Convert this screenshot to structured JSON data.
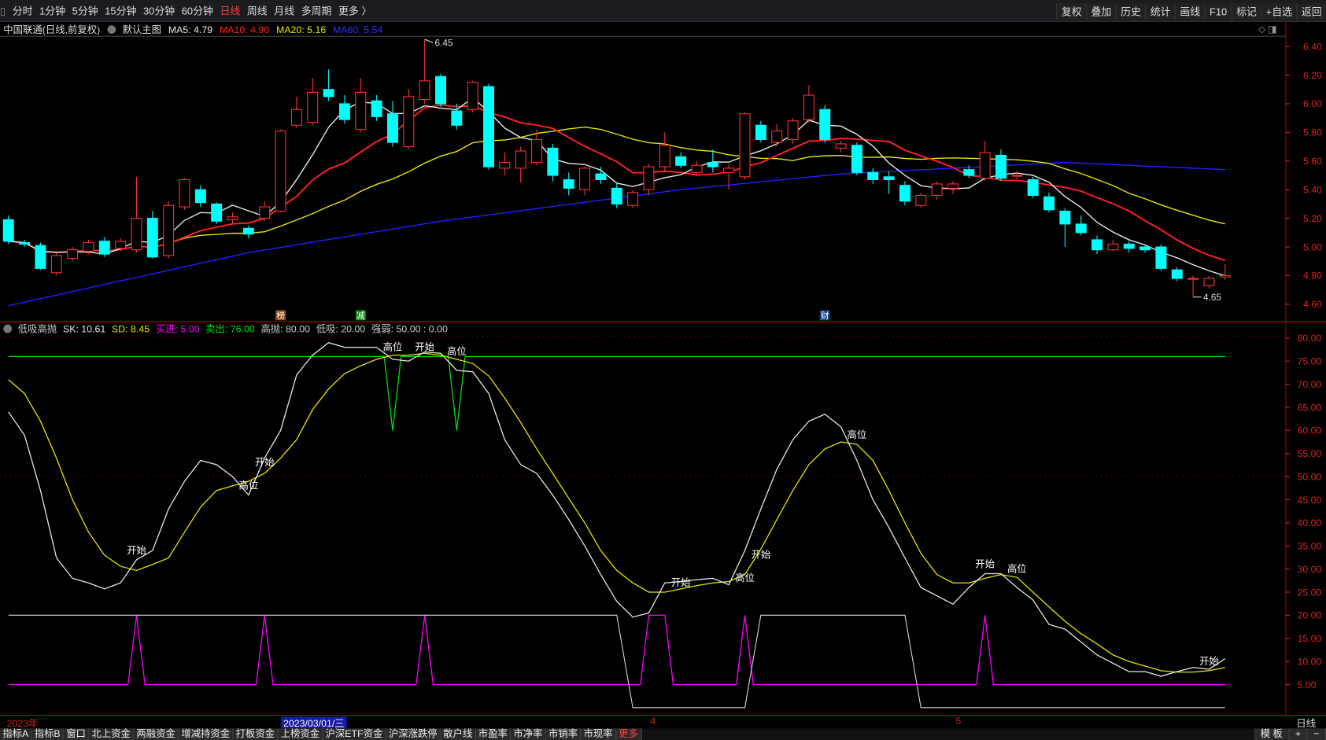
{
  "toolbar": {
    "periods": [
      "分时",
      "1分钟",
      "5分钟",
      "15分钟",
      "30分钟",
      "60分钟",
      "日线",
      "周线",
      "月线",
      "多周期",
      "更多 〉"
    ],
    "active": "日线",
    "tools": [
      "复权",
      "叠加",
      "历史",
      "统计",
      "画线",
      "F10",
      "标记",
      "+自选",
      "返回"
    ]
  },
  "legend": {
    "title": "中国联通(日线,前复权)",
    "main": "默认主图",
    "ma5": "MA5: 4.79",
    "ma10": "MA10: 4.90",
    "ma20": "MA20: 5.16",
    "ma60": "MA60: 5.54"
  },
  "indicator_legend": {
    "name": "低吸高抛",
    "sk": "SK: 10.61",
    "sd": "SD: 8.45",
    "buy": "买进: 5.00",
    "sell": "卖出: 76.00",
    "high": "高抛: 80.00",
    "low": "低吸: 20.00",
    "strength": "强弱: 50.00 : 0.00"
  },
  "colors": {
    "up": "#ff3232",
    "down": "#00ffff",
    "ma5": "#e8e8e8",
    "ma10": "#ff2020",
    "ma20": "#e6e600",
    "ma60": "#2020ff",
    "axis": "#e02020",
    "sk": "#e8e8e8",
    "sd": "#e6e600",
    "buy": "#ff00ff",
    "sell": "#00e000"
  },
  "chart_data": [
    {
      "type": "candlestick",
      "title": "中国联通 日线",
      "ylim": [
        4.55,
        6.5
      ],
      "yticks": [
        "6.40",
        "6.20",
        "6.00",
        "5.80",
        "5.60",
        "5.40",
        "5.20",
        "5.00",
        "4.80",
        "4.60"
      ],
      "ohlc": [
        [
          5.19,
          5.22,
          5.02,
          5.04
        ],
        [
          5.03,
          5.05,
          5.0,
          5.02
        ],
        [
          5.01,
          5.03,
          4.84,
          4.85
        ],
        [
          4.82,
          4.96,
          4.8,
          4.94
        ],
        [
          4.92,
          5.0,
          4.9,
          4.98
        ],
        [
          4.97,
          5.05,
          4.95,
          5.03
        ],
        [
          5.04,
          5.07,
          4.93,
          4.95
        ],
        [
          4.99,
          5.06,
          4.97,
          5.04
        ],
        [
          4.98,
          5.49,
          4.96,
          5.2
        ],
        [
          5.2,
          5.25,
          4.92,
          4.93
        ],
        [
          4.94,
          5.32,
          4.92,
          5.29
        ],
        [
          5.28,
          5.48,
          5.26,
          5.47
        ],
        [
          5.4,
          5.43,
          5.28,
          5.31
        ],
        [
          5.3,
          5.31,
          5.16,
          5.18
        ],
        [
          5.19,
          5.24,
          5.16,
          5.21
        ],
        [
          5.13,
          5.15,
          5.06,
          5.09
        ],
        [
          5.2,
          5.32,
          5.18,
          5.28
        ],
        [
          5.25,
          5.82,
          5.24,
          5.81
        ],
        [
          5.85,
          6.05,
          5.83,
          5.96
        ],
        [
          5.87,
          6.18,
          5.85,
          6.08
        ],
        [
          6.1,
          6.24,
          6.02,
          6.05
        ],
        [
          6.0,
          6.06,
          5.86,
          5.89
        ],
        [
          5.82,
          6.18,
          5.8,
          6.08
        ],
        [
          6.02,
          6.06,
          5.88,
          5.91
        ],
        [
          5.93,
          6.02,
          5.7,
          5.73
        ],
        [
          5.7,
          6.1,
          5.68,
          6.05
        ],
        [
          6.03,
          6.45,
          6.0,
          6.16
        ],
        [
          6.19,
          6.21,
          5.98,
          6.0
        ],
        [
          5.95,
          6.0,
          5.82,
          5.85
        ],
        [
          5.96,
          6.16,
          5.94,
          6.15
        ],
        [
          6.12,
          6.14,
          5.54,
          5.56
        ],
        [
          5.55,
          5.66,
          5.5,
          5.59
        ],
        [
          5.55,
          5.7,
          5.45,
          5.67
        ],
        [
          5.59,
          5.82,
          5.57,
          5.75
        ],
        [
          5.69,
          5.72,
          5.46,
          5.5
        ],
        [
          5.47,
          5.52,
          5.36,
          5.41
        ],
        [
          5.4,
          5.56,
          5.36,
          5.55
        ],
        [
          5.51,
          5.56,
          5.44,
          5.47
        ],
        [
          5.41,
          5.45,
          5.27,
          5.3
        ],
        [
          5.29,
          5.4,
          5.27,
          5.38
        ],
        [
          5.4,
          5.58,
          5.36,
          5.56
        ],
        [
          5.56,
          5.8,
          5.52,
          5.71
        ],
        [
          5.63,
          5.66,
          5.55,
          5.57
        ],
        [
          5.52,
          5.6,
          5.5,
          5.57
        ],
        [
          5.59,
          5.68,
          5.52,
          5.56
        ],
        [
          5.52,
          5.58,
          5.4,
          5.55
        ],
        [
          5.49,
          5.94,
          5.47,
          5.93
        ],
        [
          5.85,
          5.88,
          5.73,
          5.75
        ],
        [
          5.73,
          5.86,
          5.7,
          5.81
        ],
        [
          5.75,
          5.9,
          5.72,
          5.88
        ],
        [
          5.89,
          6.13,
          5.87,
          6.06
        ],
        [
          5.96,
          5.99,
          5.73,
          5.75
        ],
        [
          5.69,
          5.74,
          5.66,
          5.72
        ],
        [
          5.71,
          5.73,
          5.5,
          5.52
        ],
        [
          5.52,
          5.55,
          5.44,
          5.47
        ],
        [
          5.49,
          5.53,
          5.37,
          5.47
        ],
        [
          5.43,
          5.46,
          5.29,
          5.32
        ],
        [
          5.29,
          5.38,
          5.27,
          5.36
        ],
        [
          5.36,
          5.46,
          5.33,
          5.44
        ],
        [
          5.41,
          5.46,
          5.37,
          5.44
        ],
        [
          5.54,
          5.57,
          5.48,
          5.5
        ],
        [
          5.48,
          5.74,
          5.46,
          5.66
        ],
        [
          5.64,
          5.68,
          5.46,
          5.48
        ],
        [
          5.5,
          5.53,
          5.47,
          5.5
        ],
        [
          5.47,
          5.49,
          5.34,
          5.36
        ],
        [
          5.35,
          5.38,
          5.24,
          5.26
        ],
        [
          5.25,
          5.27,
          5.0,
          5.16
        ],
        [
          5.16,
          5.22,
          5.08,
          5.1
        ],
        [
          5.05,
          5.08,
          4.95,
          4.98
        ],
        [
          4.98,
          5.05,
          4.97,
          5.02
        ],
        [
          5.02,
          5.04,
          4.96,
          4.99
        ],
        [
          5.0,
          5.01,
          4.96,
          4.98
        ],
        [
          5.0,
          5.02,
          4.83,
          4.85
        ],
        [
          4.84,
          4.86,
          4.76,
          4.78
        ],
        [
          4.78,
          4.8,
          4.65,
          4.78
        ],
        [
          4.73,
          4.8,
          4.71,
          4.78
        ],
        [
          4.79,
          4.88,
          4.77,
          4.8
        ]
      ],
      "ma60": [
        [
          0,
          4.59
        ],
        [
          15,
          4.96
        ],
        [
          27,
          5.18
        ],
        [
          42,
          5.4
        ],
        [
          52,
          5.51
        ],
        [
          66,
          5.59
        ],
        [
          76,
          5.54
        ]
      ],
      "annotations": [
        {
          "index": 26,
          "text": "6.45"
        },
        {
          "index": 74,
          "text": "4.65"
        }
      ],
      "markers": [
        {
          "index": 17,
          "text": "榜",
          "color": "#8a4a10"
        },
        {
          "index": 22,
          "text": "减",
          "color": "#108a10"
        },
        {
          "index": 51,
          "text": "财",
          "color": "#10407a"
        }
      ]
    },
    {
      "type": "line",
      "title": "低吸高抛",
      "ylim": [
        0,
        82
      ],
      "yticks": [
        "80.00",
        "75.00",
        "70.00",
        "65.00",
        "60.00",
        "55.00",
        "50.00",
        "45.00",
        "40.00",
        "35.00",
        "30.00",
        "25.00",
        "20.00",
        "15.00",
        "10.00",
        "5.00"
      ],
      "sk": [
        64,
        59,
        47,
        32.4,
        28,
        27,
        25.7,
        27,
        32,
        34,
        43,
        49,
        53.5,
        52.6,
        50,
        46,
        54,
        60,
        72,
        76.3,
        79,
        78,
        78,
        78,
        75.4,
        75,
        77,
        76.7,
        73,
        72.7,
        68,
        58,
        52.6,
        50.7,
        46,
        40.7,
        35,
        28.8,
        23,
        19.6,
        20.5,
        27,
        27.3,
        27.7,
        28,
        26.6,
        34,
        43,
        51.6,
        58,
        62,
        63.5,
        60.8,
        53.5,
        45,
        39,
        32.4,
        26,
        24.2,
        22.4,
        26,
        29,
        29,
        26,
        23.3,
        18,
        17,
        14.2,
        11.4,
        9.6,
        7.8,
        7.8,
        6.8,
        7.8,
        8.7,
        8.3,
        10.6
      ],
      "sd": [
        71,
        68,
        62,
        54,
        45,
        38,
        33,
        30.6,
        29.7,
        31,
        32.4,
        38,
        43.4,
        47,
        48,
        49,
        50.7,
        54,
        58,
        64.5,
        69,
        72.3,
        74,
        75.4,
        76.3,
        76.3,
        76.7,
        76.3,
        75.4,
        74.5,
        71.8,
        67,
        61.7,
        56,
        50.7,
        45.3,
        40,
        34,
        29.7,
        27,
        25,
        25,
        25.7,
        26.4,
        27,
        27.3,
        28.8,
        34.3,
        40.7,
        47,
        52.6,
        56,
        57.5,
        57,
        53.5,
        47,
        40,
        33.4,
        28.8,
        27,
        27,
        28,
        28.8,
        28.2,
        25,
        21.8,
        18.7,
        16,
        13.8,
        11.4,
        10,
        9,
        8,
        7.7,
        7.7,
        8,
        8.7
      ],
      "sell_line": {
        "value": 76,
        "dips": [
          24,
          28
        ],
        "dip_value": 60
      },
      "buy_line": {
        "value": 5,
        "spikes": [
          [
            8,
            8
          ],
          [
            16,
            16
          ],
          [
            26,
            26
          ],
          [
            40,
            41
          ],
          [
            46,
            46
          ],
          [
            61,
            61
          ]
        ],
        "spike_value": 20
      },
      "state_line": {
        "segments": [
          [
            0,
            38,
            20
          ],
          [
            39,
            46,
            0
          ],
          [
            47,
            56,
            20
          ],
          [
            57,
            76,
            0
          ]
        ]
      },
      "labels": [
        {
          "index": 8,
          "text": "开始",
          "v": 33
        },
        {
          "index": 15,
          "text": "高位",
          "v": 47
        },
        {
          "index": 16,
          "text": "开始",
          "v": 52
        },
        {
          "index": 24,
          "text": "高位",
          "v": 77
        },
        {
          "index": 26,
          "text": "开始",
          "v": 77
        },
        {
          "index": 28,
          "text": "高位",
          "v": 76
        },
        {
          "index": 42,
          "text": "开始",
          "v": 26
        },
        {
          "index": 46,
          "text": "高位",
          "v": 27
        },
        {
          "index": 47,
          "text": "开始",
          "v": 32
        },
        {
          "index": 53,
          "text": "高位",
          "v": 58
        },
        {
          "index": 61,
          "text": "开始",
          "v": 30
        },
        {
          "index": 63,
          "text": "高位",
          "v": 29
        },
        {
          "index": 75,
          "text": "开始",
          "v": 9
        }
      ]
    }
  ],
  "datebar": {
    "year": "2023年",
    "selected": "2023/03/01/三",
    "m4": "4",
    "m5": "5",
    "period": "日线"
  },
  "tabs": [
    "指标A",
    "指标B",
    "窗口",
    "北上资金",
    "两融资金",
    "增减持资金",
    "打板资金",
    "上榜资金",
    "沪深ETF资金",
    "沪深涨跌停",
    "散户线",
    "市盈率",
    "市净率",
    "市销率",
    "市现率",
    "更多"
  ],
  "tabs_right": [
    "模 板",
    "+",
    "−"
  ]
}
